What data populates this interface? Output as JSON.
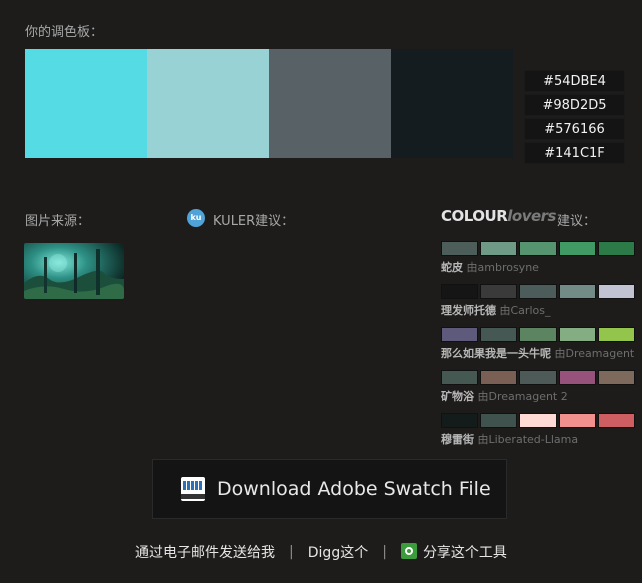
{
  "palette": {
    "title": "你的调色板：",
    "colors": [
      "#54DBE4",
      "#98D2D5",
      "#576166",
      "#141C1F"
    ]
  },
  "source": {
    "label": "图片来源："
  },
  "kuler": {
    "icon_text": "ku",
    "label": "KULER建议："
  },
  "colourlovers": {
    "logo_bold": "COLOUR",
    "logo_italic": "lovers",
    "suffix": "建议：",
    "items": [
      {
        "name": "蛇皮",
        "by": "由ambrosyne",
        "colors": [
          "#4d5d59",
          "#6f9b86",
          "#55946f",
          "#3f9a63",
          "#2d7a49"
        ]
      },
      {
        "name": "理发师托德",
        "by": "由Carlos_",
        "colors": [
          "#151515",
          "#3a3a3a",
          "#4b5c5a",
          "#728b86",
          "#c2c3d2"
        ]
      },
      {
        "name": "那么如果我是一头牛呢",
        "by": "由Dreamagent",
        "colors": [
          "#5e5a7c",
          "#455854",
          "#5c8461",
          "#84ad83",
          "#93c44b"
        ]
      },
      {
        "name": "矿物浴",
        "by": "由Dreamagent 2",
        "colors": [
          "#455952",
          "#7a5f55",
          "#4e5a58",
          "#96527a",
          "#7d6a5d"
        ]
      },
      {
        "name": "穆雷街",
        "by": "由Liberated-Llama",
        "colors": [
          "#141c1b",
          "#3f524e",
          "#ffd9d3",
          "#f1908c",
          "#cf5e62"
        ]
      }
    ]
  },
  "download": {
    "label": "Download Adobe Swatch File",
    "icon": "swatch-file-icon"
  },
  "footer": {
    "email": "通过电子邮件发送给我",
    "sep": "|",
    "digg": "Digg这个",
    "share": "分享这个工具"
  }
}
